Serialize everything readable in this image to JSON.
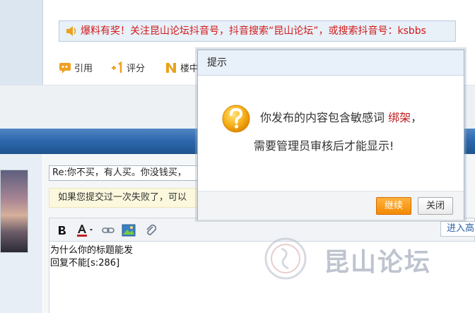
{
  "post": {
    "notice": "爆料有奖！关注昆山论坛抖音号，抖音搜索“昆山论坛”，或搜索抖音号：ksbbs",
    "actions": [
      {
        "label": "引用",
        "icon": "quote-icon"
      },
      {
        "label": "评分",
        "icon": "plus-one-icon"
      },
      {
        "label": "楼中",
        "icon": "n-icon"
      }
    ]
  },
  "reply": {
    "title_value": "Re:你不买，有人买。你没钱买，",
    "fail_tip": "如果您提交过一次失败了，可以",
    "advanced_label": "进入高",
    "content_lines": [
      "为什么你的标题能发",
      "回复不能[s:286]"
    ]
  },
  "watermark": {
    "text": "昆山论坛"
  },
  "dialog": {
    "title": "提示",
    "message_prefix": "你发布的内容包含敏感词",
    "keyword": "绑架",
    "message_suffix": "，",
    "message_line2": "需要管理员审核后才能显示!",
    "continue_label": "继续",
    "close_label": "关闭"
  },
  "colors": {
    "accent_orange": "#f28a00",
    "keyword_red": "#c21f1f",
    "notice_red": "#d11a1a",
    "header_blue": "#2d66ac"
  }
}
